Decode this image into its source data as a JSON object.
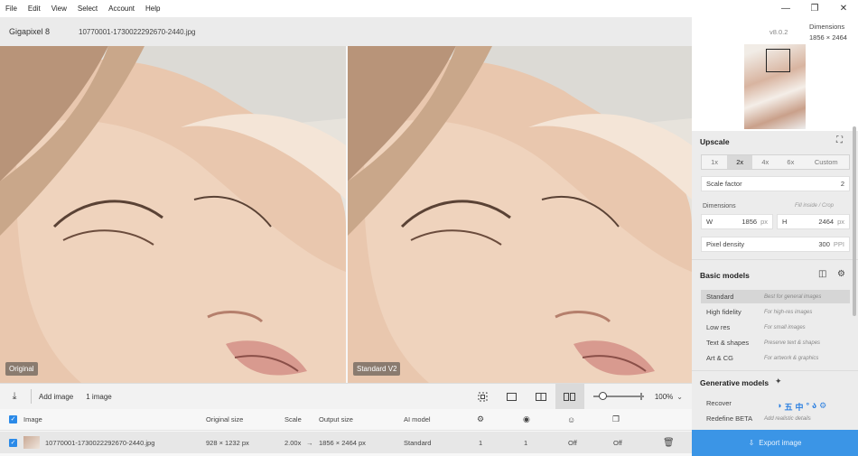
{
  "menu": [
    "File",
    "Edit",
    "View",
    "Select",
    "Account",
    "Help"
  ],
  "app": {
    "name": "Gigapixel 8",
    "filename": "10770001-1730022292670-2440.jpg",
    "version": "v8.0.2"
  },
  "preview": {
    "dimensions_label": "Dimensions",
    "dimensions_value": "1856 × 2464"
  },
  "viewer": {
    "left_label": "Original",
    "right_label": "Standard V2"
  },
  "toolbar": {
    "add_image": "Add image",
    "count_label": "1 image",
    "zoom": "100%"
  },
  "table": {
    "headers": {
      "image": "Image",
      "original_size": "Original size",
      "scale": "Scale",
      "output_size": "Output size",
      "ai_model": "AI model"
    },
    "row": {
      "filename": "10770001-1730022292670-2440.jpg",
      "original_size": "928 × 1232 px",
      "scale": "2.00x",
      "output_size": "1856 × 2464 px",
      "ai_model": "Standard",
      "col1": "1",
      "col2": "1",
      "col3": "Off",
      "col4": "Off"
    }
  },
  "upscale": {
    "title": "Upscale",
    "scales": [
      "1x",
      "2x",
      "4x",
      "6x",
      "Custom"
    ],
    "selected_scale": "2x",
    "scale_factor_label": "Scale factor",
    "scale_factor_value": "2",
    "dimensions_label": "Dimensions",
    "dimensions_hint": "Fill inside / Crop",
    "width_label": "W",
    "width_value": "1856",
    "width_unit": "px",
    "height_label": "H",
    "height_value": "2464",
    "height_unit": "px",
    "pixel_density_label": "Pixel density",
    "pixel_density_value": "300",
    "pixel_density_unit": "PPI"
  },
  "basic_models": {
    "title": "Basic models",
    "items": [
      {
        "name": "Standard",
        "desc": "Best for general images"
      },
      {
        "name": "High fidelity",
        "desc": "For high-res images"
      },
      {
        "name": "Low res",
        "desc": "For small images"
      },
      {
        "name": "Text & shapes",
        "desc": "Preserve text & shapes"
      },
      {
        "name": "Art & CG",
        "desc": "For artwork & graphics"
      }
    ]
  },
  "generative_models": {
    "title": "Generative models",
    "items": [
      {
        "name": "Recover",
        "desc": ""
      },
      {
        "name": "Redefine BETA",
        "desc": "Add realistic details"
      }
    ]
  },
  "export": {
    "label": "Export image"
  },
  "ime_glyphs": [
    "五",
    "中",
    "°",
    "ა"
  ]
}
